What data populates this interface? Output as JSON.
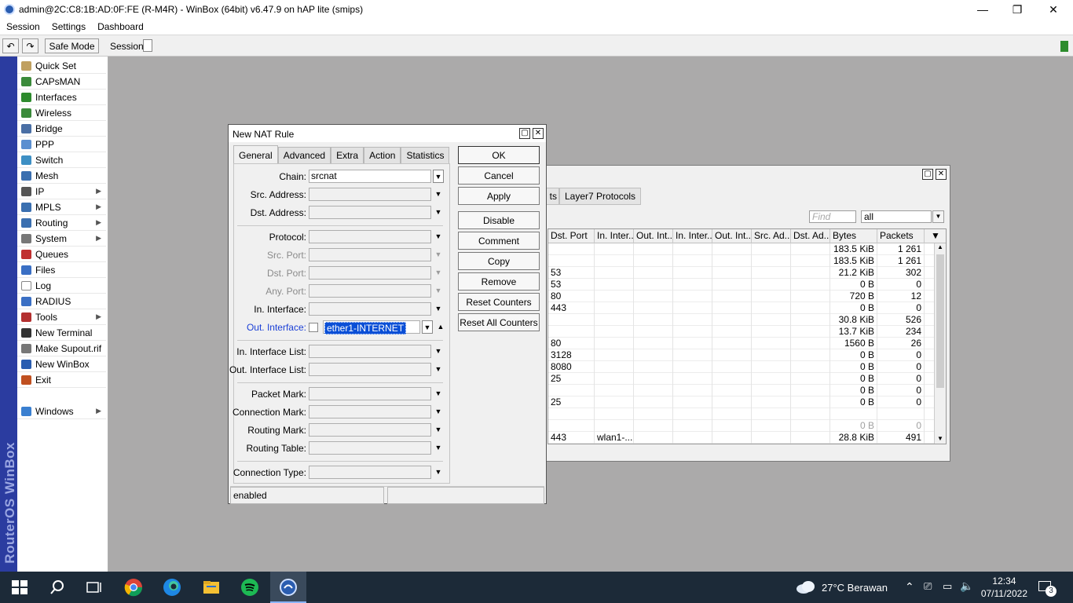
{
  "window": {
    "title": "admin@2C:C8:1B:AD:0F:FE (R-M4R) - WinBox (64bit) v6.47.9 on hAP lite (smips)",
    "minimize": "—",
    "restore": "❐",
    "close": "✕"
  },
  "menubar": [
    "Session",
    "Settings",
    "Dashboard"
  ],
  "toolbar": {
    "undo_icon": "↶",
    "redo_icon": "↷",
    "safe_mode": "Safe Mode",
    "session_label": "Session:"
  },
  "sidebar": {
    "brand": "RouterOS WinBox",
    "items": [
      {
        "label": "Quick Set",
        "icon": "wand-icon",
        "color": "#c0a060",
        "submenu": false
      },
      {
        "label": "CAPsMAN",
        "icon": "antenna-icon",
        "color": "#3a8a3a",
        "submenu": false
      },
      {
        "label": "Interfaces",
        "icon": "interfaces-icon",
        "color": "#2e8b2e",
        "submenu": false
      },
      {
        "label": "Wireless",
        "icon": "wifi-icon",
        "color": "#3a8a3a",
        "submenu": false
      },
      {
        "label": "Bridge",
        "icon": "bridge-icon",
        "color": "#4a6fa5",
        "submenu": false
      },
      {
        "label": "PPP",
        "icon": "ppp-icon",
        "color": "#5b8fd0",
        "submenu": false
      },
      {
        "label": "Switch",
        "icon": "switch-icon",
        "color": "#3d8fc4",
        "submenu": false
      },
      {
        "label": "Mesh",
        "icon": "mesh-icon",
        "color": "#3a6fb0",
        "submenu": false
      },
      {
        "label": "IP",
        "icon": "ip-icon",
        "color": "#555555",
        "submenu": true
      },
      {
        "label": "MPLS",
        "icon": "mpls-icon",
        "color": "#3a6fb0",
        "submenu": true
      },
      {
        "label": "Routing",
        "icon": "routing-icon",
        "color": "#3a6fb0",
        "submenu": true
      },
      {
        "label": "System",
        "icon": "gear-icon",
        "color": "#777777",
        "submenu": true
      },
      {
        "label": "Queues",
        "icon": "queues-icon",
        "color": "#c03030",
        "submenu": false
      },
      {
        "label": "Files",
        "icon": "files-icon",
        "color": "#3a6fc4",
        "submenu": false
      },
      {
        "label": "Log",
        "icon": "log-icon",
        "color": "#ffffff",
        "submenu": false
      },
      {
        "label": "RADIUS",
        "icon": "radius-icon",
        "color": "#3a6fc4",
        "submenu": false
      },
      {
        "label": "Tools",
        "icon": "tools-icon",
        "color": "#b33030",
        "submenu": true
      },
      {
        "label": "New Terminal",
        "icon": "terminal-icon",
        "color": "#333333",
        "submenu": false
      },
      {
        "label": "Make Supout.rif",
        "icon": "supout-icon",
        "color": "#777777",
        "submenu": false
      },
      {
        "label": "New WinBox",
        "icon": "winbox-icon",
        "color": "#2a5db0",
        "submenu": false
      },
      {
        "label": "Exit",
        "icon": "exit-icon",
        "color": "#c05020",
        "submenu": false
      },
      {
        "label": "Windows",
        "icon": "windows-icon",
        "color": "#3a7fd0",
        "submenu": true
      }
    ]
  },
  "bg_window": {
    "tabs": [
      "ts",
      "Layer7 Protocols"
    ],
    "find_placeholder": "Find",
    "filter_value": "all",
    "columns": [
      "Dst. Port",
      "In. Inter...",
      "Out. Int...",
      "In. Inter...",
      "Out. Int...",
      "Src. Ad...",
      "Dst. Ad...",
      "Bytes",
      "Packets"
    ],
    "rows": [
      {
        "dst_port": "",
        "in_if": "",
        "bytes": "183.5 KiB",
        "packets": "1 261",
        "dim": false
      },
      {
        "dst_port": "",
        "in_if": "",
        "bytes": "183.5 KiB",
        "packets": "1 261",
        "dim": false
      },
      {
        "dst_port": "53",
        "in_if": "",
        "bytes": "21.2 KiB",
        "packets": "302",
        "dim": false
      },
      {
        "dst_port": "53",
        "in_if": "",
        "bytes": "0 B",
        "packets": "0",
        "dim": false
      },
      {
        "dst_port": "80",
        "in_if": "",
        "bytes": "720 B",
        "packets": "12",
        "dim": false
      },
      {
        "dst_port": "443",
        "in_if": "",
        "bytes": "0 B",
        "packets": "0",
        "dim": false
      },
      {
        "dst_port": "",
        "in_if": "",
        "bytes": "30.8 KiB",
        "packets": "526",
        "dim": false
      },
      {
        "dst_port": "",
        "in_if": "",
        "bytes": "13.7 KiB",
        "packets": "234",
        "dim": false
      },
      {
        "dst_port": "80",
        "in_if": "",
        "bytes": "1560 B",
        "packets": "26",
        "dim": false
      },
      {
        "dst_port": "3128",
        "in_if": "",
        "bytes": "0 B",
        "packets": "0",
        "dim": false
      },
      {
        "dst_port": "8080",
        "in_if": "",
        "bytes": "0 B",
        "packets": "0",
        "dim": false
      },
      {
        "dst_port": "25",
        "in_if": "",
        "bytes": "0 B",
        "packets": "0",
        "dim": false
      },
      {
        "dst_port": "",
        "in_if": "",
        "bytes": "0 B",
        "packets": "0",
        "dim": false
      },
      {
        "dst_port": "25",
        "in_if": "",
        "bytes": "0 B",
        "packets": "0",
        "dim": false
      },
      {
        "dst_port": "",
        "in_if": "",
        "bytes": "",
        "packets": "",
        "dim": false
      },
      {
        "dst_port": "",
        "in_if": "",
        "bytes": "0 B",
        "packets": "0",
        "dim": true
      },
      {
        "dst_port": "443",
        "in_if": "wlan1-...",
        "bytes": "28.8 KiB",
        "packets": "491",
        "dim": false
      }
    ]
  },
  "dialog": {
    "title": "New NAT Rule",
    "tabs": [
      "General",
      "Advanced",
      "Extra",
      "Action",
      "Statistics"
    ],
    "active_tab": "General",
    "fields": {
      "chain": {
        "label": "Chain:",
        "value": "srcnat"
      },
      "src_address": {
        "label": "Src. Address:",
        "value": ""
      },
      "dst_address": {
        "label": "Dst. Address:",
        "value": ""
      },
      "protocol": {
        "label": "Protocol:",
        "value": ""
      },
      "src_port": {
        "label": "Src. Port:",
        "value": ""
      },
      "dst_port": {
        "label": "Dst. Port:",
        "value": ""
      },
      "any_port": {
        "label": "Any. Port:",
        "value": ""
      },
      "in_interface": {
        "label": "In. Interface:",
        "value": ""
      },
      "out_interface": {
        "label": "Out. Interface:",
        "value": "ether1-INTERNET"
      },
      "in_interface_list": {
        "label": "In. Interface List:",
        "value": ""
      },
      "out_interface_list": {
        "label": "Out. Interface List:",
        "value": ""
      },
      "packet_mark": {
        "label": "Packet Mark:",
        "value": ""
      },
      "connection_mark": {
        "label": "Connection Mark:",
        "value": ""
      },
      "routing_mark": {
        "label": "Routing Mark:",
        "value": ""
      },
      "routing_table": {
        "label": "Routing Table:",
        "value": ""
      },
      "connection_type": {
        "label": "Connection Type:",
        "value": ""
      }
    },
    "buttons": {
      "ok": "OK",
      "cancel": "Cancel",
      "apply": "Apply",
      "disable": "Disable",
      "comment": "Comment",
      "copy": "Copy",
      "remove": "Remove",
      "reset_counters": "Reset Counters",
      "reset_all_counters": "Reset All Counters"
    },
    "status": "enabled"
  },
  "taskbar": {
    "weather": "27°C  Berawan",
    "time": "12:34",
    "date": "07/11/2022",
    "notifications": "3"
  },
  "colors": {
    "selection": "#0a4fd6",
    "sidebar_stripe": "#2b3ca0",
    "desktop": "#abaaaa",
    "taskbar": "#1c2a38"
  }
}
